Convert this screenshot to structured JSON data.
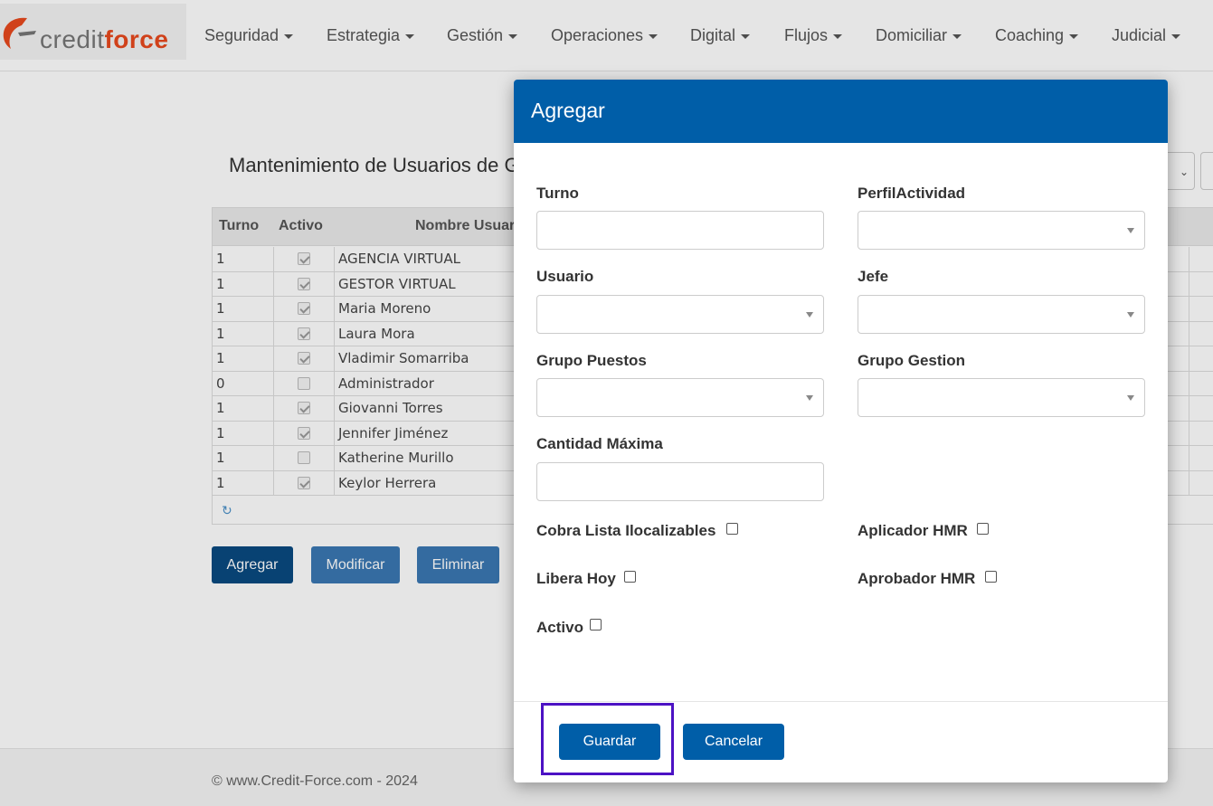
{
  "brand": {
    "credit": "credit",
    "force": "force",
    "accent": "#e8491d"
  },
  "nav": {
    "items": [
      "Seguridad",
      "Estrategia",
      "Gestión",
      "Operaciones",
      "Digital",
      "Flujos",
      "Domiciliar",
      "Coaching",
      "Judicial"
    ]
  },
  "page": {
    "title": "Mantenimiento de Usuarios de G",
    "columns": {
      "turno": "Turno",
      "activo": "Activo",
      "nombre": "Nombre Usuar"
    },
    "rows": [
      {
        "turno": "1",
        "activo": true,
        "nombre": "AGENCIA VIRTUAL"
      },
      {
        "turno": "1",
        "activo": true,
        "nombre": "GESTOR VIRTUAL"
      },
      {
        "turno": "1",
        "activo": true,
        "nombre": "Maria Moreno"
      },
      {
        "turno": "1",
        "activo": true,
        "nombre": "Laura Mora"
      },
      {
        "turno": "1",
        "activo": true,
        "nombre": "Vladimir Somarriba"
      },
      {
        "turno": "0",
        "activo": false,
        "nombre": "Administrador"
      },
      {
        "turno": "1",
        "activo": true,
        "nombre": "Giovanni Torres"
      },
      {
        "turno": "1",
        "activo": true,
        "nombre": "Jennifer Jiménez"
      },
      {
        "turno": "1",
        "activo": false,
        "nombre": "Katherine Murillo"
      },
      {
        "turno": "1",
        "activo": true,
        "nombre": "Keylor Herrera"
      }
    ],
    "buttons": {
      "agregar": "Agregar",
      "modificar": "Modificar",
      "eliminar": "Eliminar"
    },
    "footer": "© www.Credit-Force.com - 2024"
  },
  "modal": {
    "title": "Agregar",
    "color": "#005ea8",
    "fields": {
      "turno": {
        "label": "Turno",
        "value": ""
      },
      "perfil": {
        "label": "PerfilActividad",
        "value": ""
      },
      "usuario": {
        "label": "Usuario",
        "value": ""
      },
      "jefe": {
        "label": "Jefe",
        "value": ""
      },
      "grupo_puestos": {
        "label": "Grupo Puestos",
        "value": ""
      },
      "grupo_gestion": {
        "label": "Grupo Gestion",
        "value": ""
      },
      "cantidad": {
        "label": "Cantidad Máxima",
        "value": ""
      }
    },
    "checks": {
      "cobra": "Cobra Lista Ilocalizables",
      "aplicador": "Aplicador HMR",
      "libera": "Libera Hoy",
      "aprobador": "Aprobador HMR",
      "activo": "Activo"
    },
    "buttons": {
      "guardar": "Guardar",
      "cancelar": "Cancelar"
    }
  }
}
